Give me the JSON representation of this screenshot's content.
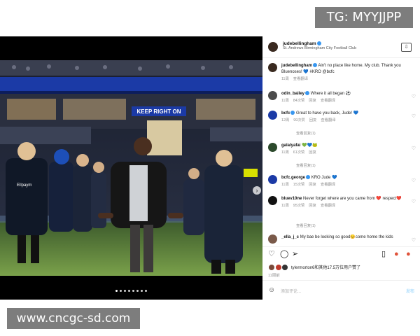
{
  "watermark_top": "TG: MYYJJPP",
  "watermark_bottom": "www.cncgc-sd.com",
  "photo": {
    "banner_text": "KEEP RIGHT ON",
    "shirt_text": "Ellpaym",
    "total_slides": 8,
    "current_slide": 1
  },
  "header": {
    "username": "judebellingham",
    "location": "St. Andrews Birmingham City Football Club"
  },
  "caption": {
    "username": "judebellingham",
    "text": "Ain't no place like home. My club. Thank you Bluenoses! 💙 #KRO @bcfc",
    "time": "11周",
    "see_translation": "查看翻译"
  },
  "comments": [
    {
      "username": "odin_bailey",
      "text": "Where it all began ⚽",
      "time": "11周",
      "likes": "84次赞",
      "reply": "回复",
      "translate": "查看翻译",
      "view_replies": ""
    },
    {
      "username": "bcfc",
      "text": "Great to have you back, Jude! 💙",
      "time": "12周",
      "likes": "99次赞",
      "reply": "回复",
      "translate": "查看翻译",
      "view_replies": "查看回复(1)"
    },
    {
      "username": "galalyafai",
      "text": "💚💙🐸",
      "time": "11周",
      "likes": "61次赞",
      "reply": "回复",
      "translate": "",
      "view_replies": "查看回复(1)"
    },
    {
      "username": "bcfc.george",
      "text": "KRO Jude 💙",
      "time": "11周",
      "likes": "15次赞",
      "reply": "回复",
      "translate": "查看翻译",
      "view_replies": ""
    },
    {
      "username": "bluev10ne",
      "text": "Never forget where are you came from ❤️ respect❤️",
      "time": "11周",
      "likes": "95次赞",
      "reply": "回复",
      "translate": "查看翻译",
      "view_replies": "查看回复(1)"
    },
    {
      "username": "_ella_j_c",
      "text": "My bae be looking so good😊come home the kids",
      "time": "",
      "likes": "",
      "reply": "",
      "translate": "",
      "view_replies": ""
    }
  ],
  "likes_text": "tylermorton6和其他17.5万位用户赞了",
  "post_time": "11周前",
  "add_comment_placeholder": "添加评论...",
  "post_button": "发布",
  "colors": {
    "club_blue": "#1b3aa6",
    "verified": "#3897f0"
  }
}
